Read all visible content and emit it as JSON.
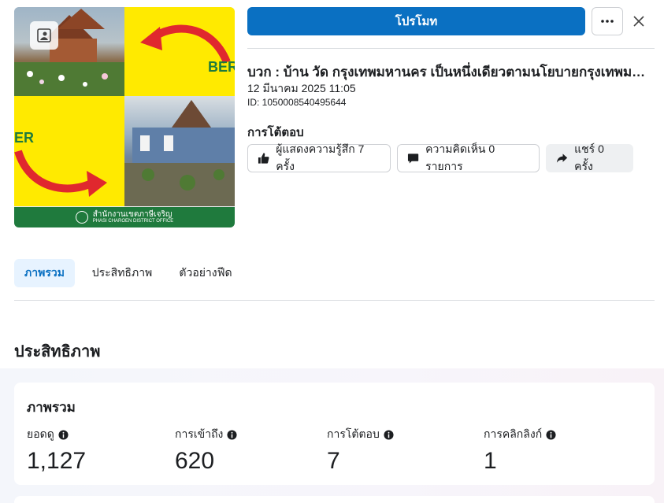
{
  "header": {
    "promote_label": "โปรโมท",
    "more_label": "•••"
  },
  "thumbnail": {
    "text_a": "BER",
    "text_b": "ER",
    "footer_text": "สำนักงานเขตภาษีเจริญ",
    "footer_subtext": "PHASI CHAROEN DISTRICT OFFICE",
    "accent_yellow": "#ffea00",
    "accent_green": "#1f7a3d",
    "arrow_red": "#e0282e"
  },
  "post": {
    "title": "บวก : บ้าน วัด กรุงเทพมหานคร เป็นหนึ่งเดียวตามนโยบายกรุงเทพมหานคร",
    "date": "12 มีนาคม 2025 11:05",
    "id": "ID: 1050008540495644"
  },
  "engagement": {
    "label": "การโต้ตอบ",
    "reactions": "ผู้แสดงความรู้สึก 7 ครั้ง",
    "comments": "ความคิดเห็น 0 รายการ",
    "shares": "แชร์ 0 ครั้ง"
  },
  "tabs": [
    {
      "label": "ภาพรวม",
      "active": true
    },
    {
      "label": "ประสิทธิภาพ",
      "active": false
    },
    {
      "label": "ตัวอย่างฟีด",
      "active": false
    }
  ],
  "performance": {
    "section_title": "ประสิทธิภาพ",
    "card_title": "ภาพรวม",
    "metrics": [
      {
        "label": "ยอดดู",
        "value": "1,127"
      },
      {
        "label": "การเข้าถึง",
        "value": "620"
      },
      {
        "label": "การโต้ตอบ",
        "value": "7"
      },
      {
        "label": "การคลิกลิงก์",
        "value": "1"
      }
    ]
  },
  "colors": {
    "primary": "#0a70c2",
    "active_tab_bg": "#e7f3ff",
    "border": "#ced0d4"
  }
}
